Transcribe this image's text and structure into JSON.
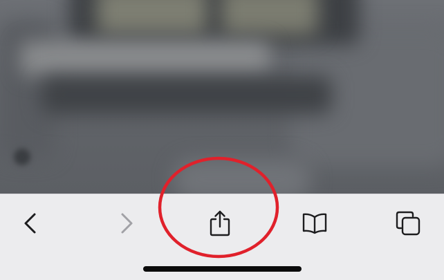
{
  "toolbar": {
    "buttons": [
      {
        "name": "back-button",
        "icon": "chevron-left-icon",
        "color": "#1c1c1e",
        "enabled": true
      },
      {
        "name": "forward-button",
        "icon": "chevron-right-icon",
        "color": "#a1a1a6",
        "enabled": false
      },
      {
        "name": "share-button",
        "icon": "share-icon",
        "color": "#1c1c1e",
        "enabled": true
      },
      {
        "name": "bookmarks-button",
        "icon": "book-icon",
        "color": "#1c1c1e",
        "enabled": true
      },
      {
        "name": "tabs-button",
        "icon": "tabs-icon",
        "color": "#1c1c1e",
        "enabled": true
      }
    ]
  },
  "annotation": {
    "shape": "ellipse",
    "color": "#e0212b",
    "target": "share-button"
  },
  "colors": {
    "toolbar_background": "#ececee",
    "home_indicator": "#0b0b0b"
  }
}
